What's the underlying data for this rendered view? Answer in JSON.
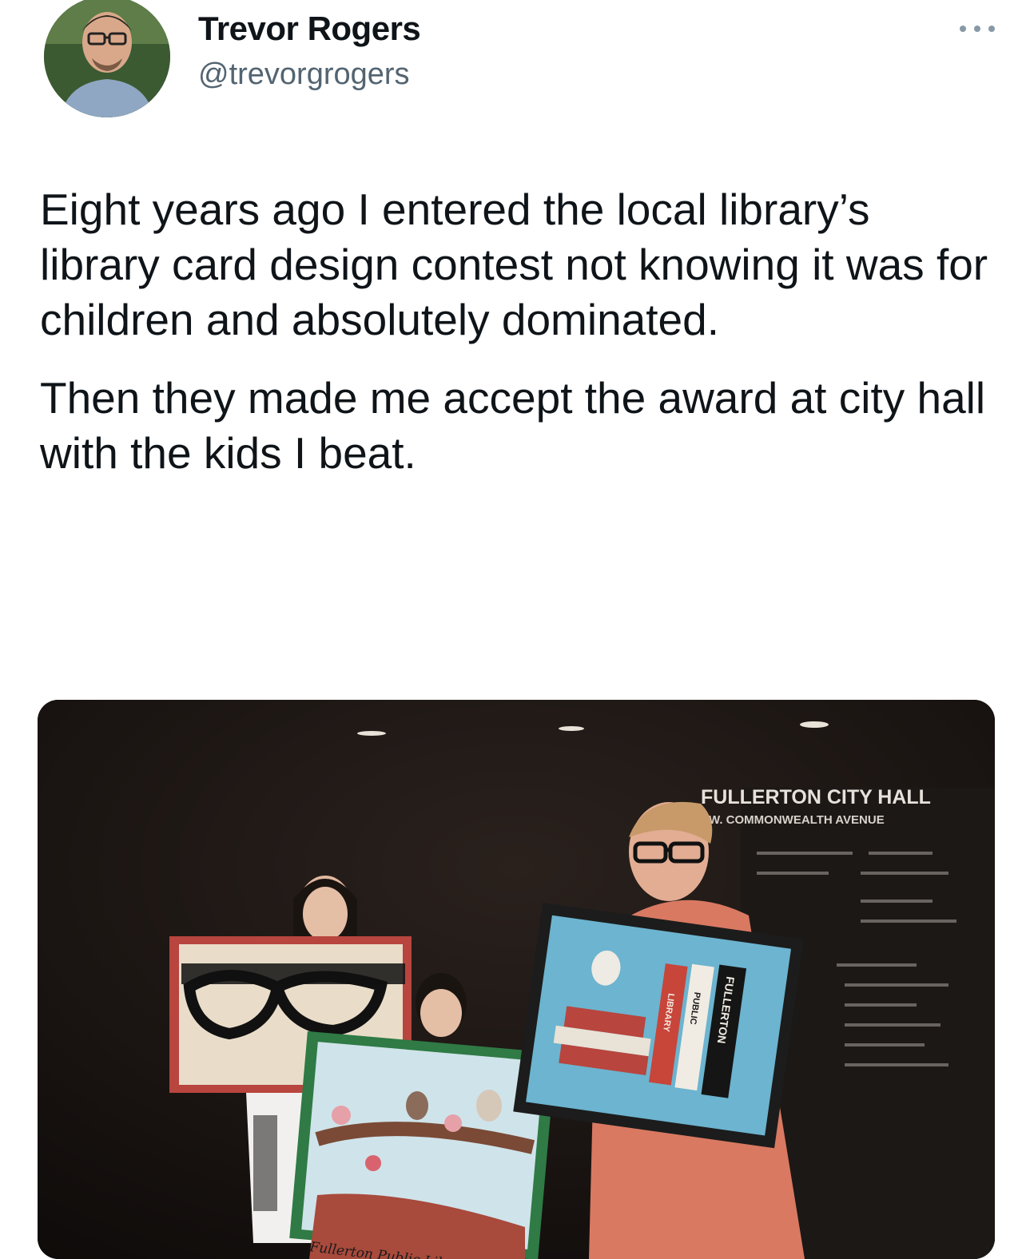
{
  "author": {
    "display_name": "Trevor Rogers",
    "handle": "@trevorgrogers",
    "avatar_icon": "profile-photo"
  },
  "more_icon": "ellipsis-icon",
  "tweet": {
    "paragraphs": [
      "Eight years ago I entered the local library’s library card design contest not knowing it was for children and absolutely dominated.",
      "Then they made me accept the award at city hall with the kids I beat."
    ]
  },
  "photo": {
    "sign_line1": "FULLERTON CITY HALL",
    "sign_line2": "W. COMMONWEALTH AVENUE",
    "spine1": "FULLERTON",
    "spine2": "PUBLIC",
    "spine3": "LIBRARY",
    "banner_text": "Fullerton Public Library"
  },
  "colors": {
    "handle_gray": "#536471",
    "card_blue": "#6cb4cf",
    "frame_red": "#b8453e",
    "frame_green": "#2f7a45"
  }
}
